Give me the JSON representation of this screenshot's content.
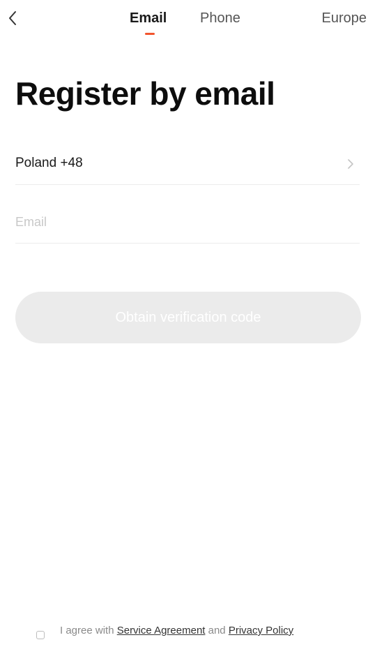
{
  "nav": {
    "back_icon": "chevron-left-icon",
    "tabs": [
      {
        "label": "Email",
        "active": true
      },
      {
        "label": "Phone",
        "active": false
      }
    ],
    "region": "Europe",
    "accent_color": "#f2542d"
  },
  "title": "Register by email",
  "country": {
    "label": "Poland +48",
    "icon": "chevron-right-icon"
  },
  "email": {
    "value": "",
    "placeholder": "Email"
  },
  "button": {
    "label": "Obtain verification code",
    "enabled": false
  },
  "agreement": {
    "checked": false,
    "prefix": "I agree with ",
    "service_link": "Service Agreement",
    "middle": " and ",
    "privacy_link": "Privacy Policy"
  }
}
